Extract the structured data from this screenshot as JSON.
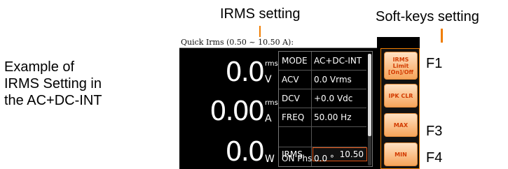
{
  "annotations": {
    "irms_setting": "IRMS setting",
    "softkeys_setting": "Soft-keys setting",
    "example_lines": [
      "Example of",
      "IRMS Setting in",
      "the AC+DC-INT"
    ],
    "f1": "F1",
    "f3": "F3",
    "f4": "F4"
  },
  "screen": {
    "title": "Quick Irms (0.50 ~ 10.50 A):",
    "readings": [
      {
        "value": "0.0",
        "sup": "rms",
        "unit": "V"
      },
      {
        "value": "0.00",
        "sup": "rms",
        "unit": "A"
      },
      {
        "value": "0.0",
        "sup": "",
        "unit": "W"
      }
    ],
    "params": [
      {
        "label": "MODE",
        "value": "AC+DC-INT"
      },
      {
        "label": "ACV",
        "value": "0.0 Vrms"
      },
      {
        "label": "DCV",
        "value": "+0.0 Vdc"
      },
      {
        "label": "FREQ",
        "value": "50.00 Hz"
      },
      {
        "label": "IRMS",
        "value": "10.50"
      },
      {
        "label": "ON Phs",
        "value": "0.0 °"
      }
    ],
    "softkeys": [
      {
        "lines": [
          "IRMS",
          "Limit",
          "[On]/Off"
        ]
      },
      {
        "lines": [
          "IPK CLR"
        ]
      },
      {
        "lines": [
          "MAX"
        ]
      },
      {
        "lines": [
          "MIN"
        ]
      }
    ]
  },
  "colors": {
    "accent": "#f07d00",
    "screen_bg": "#000000",
    "softkey_text": "#d23b00"
  }
}
